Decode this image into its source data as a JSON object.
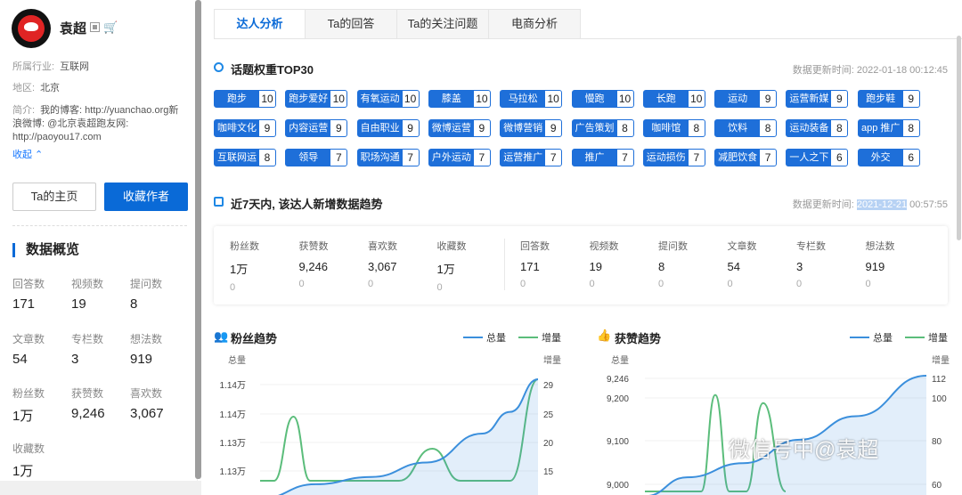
{
  "user": {
    "name": "袁超",
    "industry_label": "所属行业:",
    "industry": "互联网",
    "region_label": "地区:",
    "region": "北京",
    "intro_label": "简介:",
    "intro_lines": [
      "我的博客: http://yuanchao.org新",
      "浪微博: @北京袁超跑友网:",
      "http://paoyou17.com"
    ],
    "collapse": "收起 ⌃",
    "home_button": "Ta的主页",
    "follow_button": "收藏作者"
  },
  "overview": {
    "title": "数据概览",
    "stats": [
      {
        "label": "回答数",
        "value": "171"
      },
      {
        "label": "视频数",
        "value": "19"
      },
      {
        "label": "提问数",
        "value": "8"
      },
      {
        "label": "文章数",
        "value": "54"
      },
      {
        "label": "专栏数",
        "value": "3"
      },
      {
        "label": "想法数",
        "value": "919"
      },
      {
        "label": "粉丝数",
        "value": "1万"
      },
      {
        "label": "获赞数",
        "value": "9,246"
      },
      {
        "label": "喜欢数",
        "value": "3,067"
      },
      {
        "label": "收藏数",
        "value": "1万"
      }
    ]
  },
  "tabs": [
    "达人分析",
    "Ta的回答",
    "Ta的关注问题",
    "电商分析"
  ],
  "topics": {
    "title": "话题权重TOP30",
    "updated": "数据更新时间: 2022-01-18 00:12:45",
    "items": [
      {
        "name": "跑步",
        "count": "10"
      },
      {
        "name": "跑步爱好",
        "count": "10"
      },
      {
        "name": "有氧运动",
        "count": "10"
      },
      {
        "name": "膝盖",
        "count": "10"
      },
      {
        "name": "马拉松",
        "count": "10"
      },
      {
        "name": "慢跑",
        "count": "10"
      },
      {
        "name": "长跑",
        "count": "10"
      },
      {
        "name": "运动",
        "count": "9"
      },
      {
        "name": "运营新媒",
        "count": "9"
      },
      {
        "name": "跑步鞋",
        "count": "9"
      },
      {
        "name": "咖啡文化",
        "count": "9"
      },
      {
        "name": "内容运营",
        "count": "9"
      },
      {
        "name": "自由职业",
        "count": "9"
      },
      {
        "name": "微博运营",
        "count": "9"
      },
      {
        "name": "微博营销",
        "count": "9"
      },
      {
        "name": "广告策划",
        "count": "8"
      },
      {
        "name": "咖啡馆",
        "count": "8"
      },
      {
        "name": "饮料",
        "count": "8"
      },
      {
        "name": "运动装备",
        "count": "8"
      },
      {
        "name": "app 推广",
        "count": "8"
      },
      {
        "name": "互联网运",
        "count": "8"
      },
      {
        "name": "领导",
        "count": "7"
      },
      {
        "name": "职场沟通",
        "count": "7"
      },
      {
        "name": "户外运动",
        "count": "7"
      },
      {
        "name": "运营推广",
        "count": "7"
      },
      {
        "name": "推广",
        "count": "7"
      },
      {
        "name": "运动损伤",
        "count": "7"
      },
      {
        "name": "减肥饮食",
        "count": "7"
      },
      {
        "name": "一人之下",
        "count": "6"
      },
      {
        "name": "外交",
        "count": "6"
      }
    ]
  },
  "trend": {
    "title": "近7天内, 该达人新增数据趋势",
    "updated_prefix": "数据更新时间: ",
    "updated_date": "2021-12-21",
    "updated_time": " 00:57:55",
    "kpis": [
      {
        "label": "粉丝数",
        "value": "1万",
        "delta": "0"
      },
      {
        "label": "获赞数",
        "value": "9,246",
        "delta": "0"
      },
      {
        "label": "喜欢数",
        "value": "3,067",
        "delta": "0"
      },
      {
        "label": "收藏数",
        "value": "1万",
        "delta": "0"
      },
      {
        "label": "回答数",
        "value": "171",
        "delta": "0"
      },
      {
        "label": "视频数",
        "value": "19",
        "delta": "0"
      },
      {
        "label": "提问数",
        "value": "8",
        "delta": "0"
      },
      {
        "label": "文章数",
        "value": "54",
        "delta": "0"
      },
      {
        "label": "专栏数",
        "value": "3",
        "delta": "0"
      },
      {
        "label": "想法数",
        "value": "919",
        "delta": "0"
      }
    ]
  },
  "colors": {
    "accent": "#0a6ad7",
    "total_line": "#3b8fdc",
    "increase_line": "#5bbd7b"
  },
  "chart_data": [
    {
      "type": "line",
      "title": "粉丝趋势",
      "legend": [
        "总量",
        "增量"
      ],
      "ylabel_left": "总量",
      "ylabel_right": "增量",
      "yticks_left": [
        "1.14万",
        "1.14万",
        "1.13万",
        "1.13万"
      ],
      "yticks_right": [
        "29",
        "25",
        "20",
        "15"
      ],
      "ylim_right": [
        10,
        29
      ],
      "series": [
        {
          "name": "总量",
          "x": [
            0.0,
            0.2,
            0.4,
            0.6,
            0.8,
            0.9,
            1.0
          ],
          "values": [
            11280,
            11300,
            11310,
            11330,
            11370,
            11400,
            11445
          ]
        },
        {
          "name": "增量",
          "x": [
            0.0,
            0.05,
            0.12,
            0.18,
            0.24,
            0.5,
            0.62,
            0.72,
            0.82,
            0.9,
            1.0
          ],
          "values": [
            10,
            10,
            22,
            10,
            10,
            10,
            16,
            10,
            10,
            10,
            29
          ]
        }
      ]
    },
    {
      "type": "line",
      "title": "获赞趋势",
      "legend": [
        "总量",
        "增量"
      ],
      "ylabel_left": "总量",
      "ylabel_right": "增量",
      "yticks_left": [
        "9,246",
        "9,200",
        "9,100",
        "9,000"
      ],
      "yticks_right": [
        "112",
        "100",
        "80",
        "60"
      ],
      "ylim_left": [
        9000,
        9246
      ],
      "ylim_right": [
        40,
        112
      ],
      "series": [
        {
          "name": "总量",
          "x": [
            0.0,
            0.15,
            0.35,
            0.55,
            0.75,
            1.0
          ],
          "values": [
            8990,
            9030,
            9060,
            9110,
            9160,
            9246
          ]
        },
        {
          "name": "增量",
          "x": [
            0.0,
            0.06,
            0.1,
            0.2,
            0.25,
            0.3,
            0.36,
            0.42,
            0.5
          ],
          "values": [
            40,
            40,
            40,
            40,
            100,
            40,
            40,
            95,
            40
          ]
        }
      ]
    }
  ],
  "watermark": "微信号中@袁超"
}
